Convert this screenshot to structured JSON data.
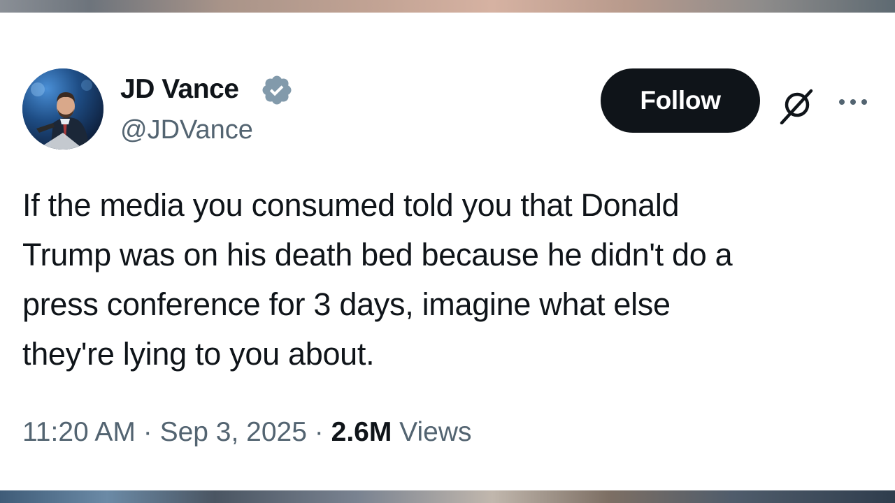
{
  "author": {
    "name": "JD Vance",
    "handle": "@JDVance",
    "verified": true,
    "avatar": "speaker-at-podium-photo",
    "verified_color": "#829aab"
  },
  "actions": {
    "follow_label": "Follow",
    "grok_icon": "grok-icon",
    "more_icon": "more-options-icon"
  },
  "tweet": {
    "text_lines": [
      "If the media you consumed told you that Donald",
      "Trump was on his death bed because he didn't do a",
      "press conference for 3 days, imagine what else",
      "they're lying to you about."
    ]
  },
  "meta": {
    "time": "11:20 AM",
    "separator": "·",
    "date": "Sep 3, 2025",
    "views_count": "2.6M",
    "views_label": "Views"
  },
  "colors": {
    "text_primary": "#0f1419",
    "text_secondary": "#536471",
    "button_bg": "#0f1419",
    "button_text": "#ffffff"
  }
}
